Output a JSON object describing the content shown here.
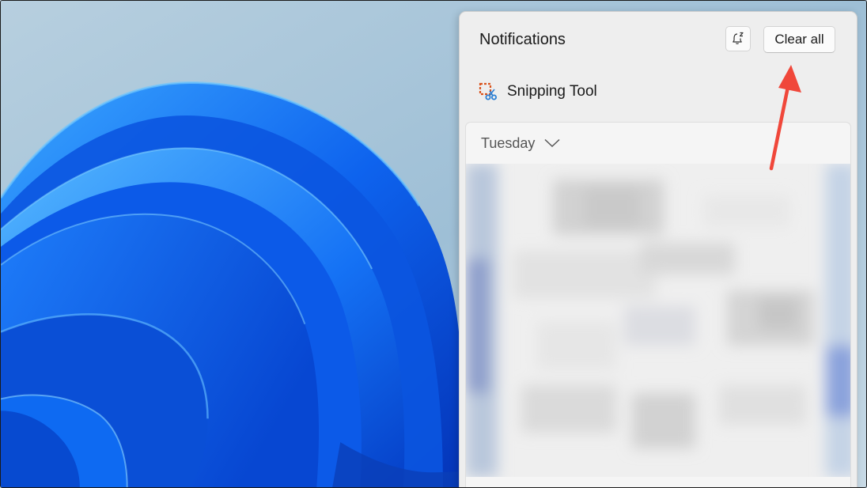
{
  "notifications": {
    "title": "Notifications",
    "clear_all_label": "Clear all",
    "dnd_icon": "bell-snooze-icon"
  },
  "app_group": {
    "icon": "snipping-tool-icon",
    "name": "Snipping Tool"
  },
  "notification_card": {
    "day_label": "Tuesday",
    "expand_icon": "chevron-down-icon",
    "content": "pixelated-blurred-screenshot"
  },
  "annotation": {
    "icon": "red-arrow-pointer",
    "color": "#f0473a"
  },
  "colors": {
    "wallpaper_background": "#c9dbe8",
    "bloom_blue": "#0a5be8",
    "panel_background": "#eeeeee"
  }
}
